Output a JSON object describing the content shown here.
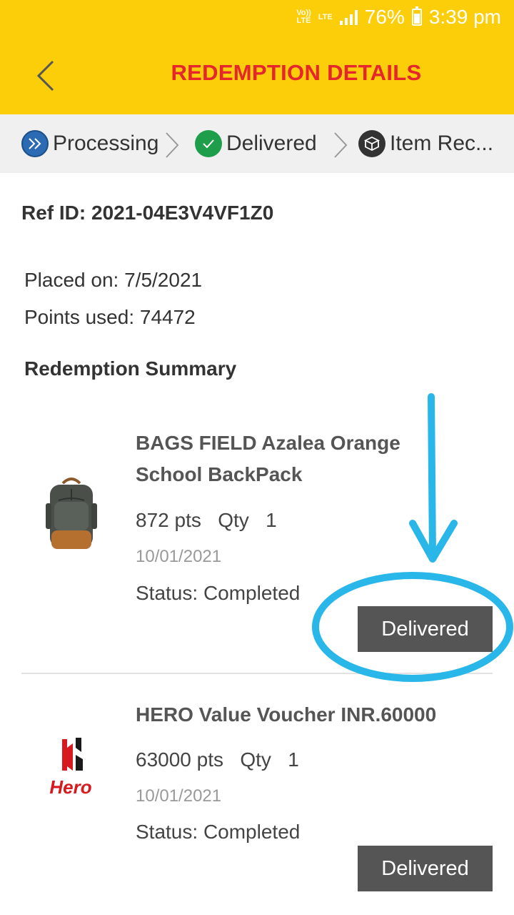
{
  "status_bar": {
    "net": "Vo)) LTE",
    "lte": "LTE",
    "battery": "76%",
    "time": "3:39 pm"
  },
  "header": {
    "title": "REDEMPTION DETAILS",
    "back_icon": "chevron-left-icon"
  },
  "steps": [
    {
      "label": "Processing",
      "icon": "double-chevron-icon",
      "color": "#2A6BB3"
    },
    {
      "label": "Delivered",
      "icon": "check-icon",
      "color": "#1E9E4B"
    },
    {
      "label": "Item Rec...",
      "icon": "box-icon",
      "color": "#333333"
    }
  ],
  "order": {
    "ref_id": "Ref ID: 2021-04E3V4VF1Z0",
    "placed_on": "Placed on: 7/5/2021",
    "points_used": "Points used: 74472",
    "summary_heading": "Redemption Summary"
  },
  "items": [
    {
      "name_line1": "BAGS FIELD Azalea Orange",
      "name_line2": "School BackPack",
      "points": "872 pts",
      "qty_label": "Qty",
      "qty": "1",
      "date": "10/01/2021",
      "status": "Status: Completed",
      "button": "Delivered",
      "image": "backpack-image"
    },
    {
      "name_line1": "HERO Value Voucher INR.60000",
      "points": "63000 pts",
      "qty_label": "Qty",
      "qty": "1",
      "date": "10/01/2021",
      "status": "Status: Completed",
      "button": "Delivered",
      "image": "hero-logo",
      "logo_text": "Hero"
    }
  ],
  "annotation": {
    "color": "#29B6E8",
    "shapes": [
      "arrow",
      "ellipse"
    ]
  },
  "colors": {
    "header_bg": "#FCCE09",
    "title": "#E5262D",
    "button_bg": "#555555"
  }
}
